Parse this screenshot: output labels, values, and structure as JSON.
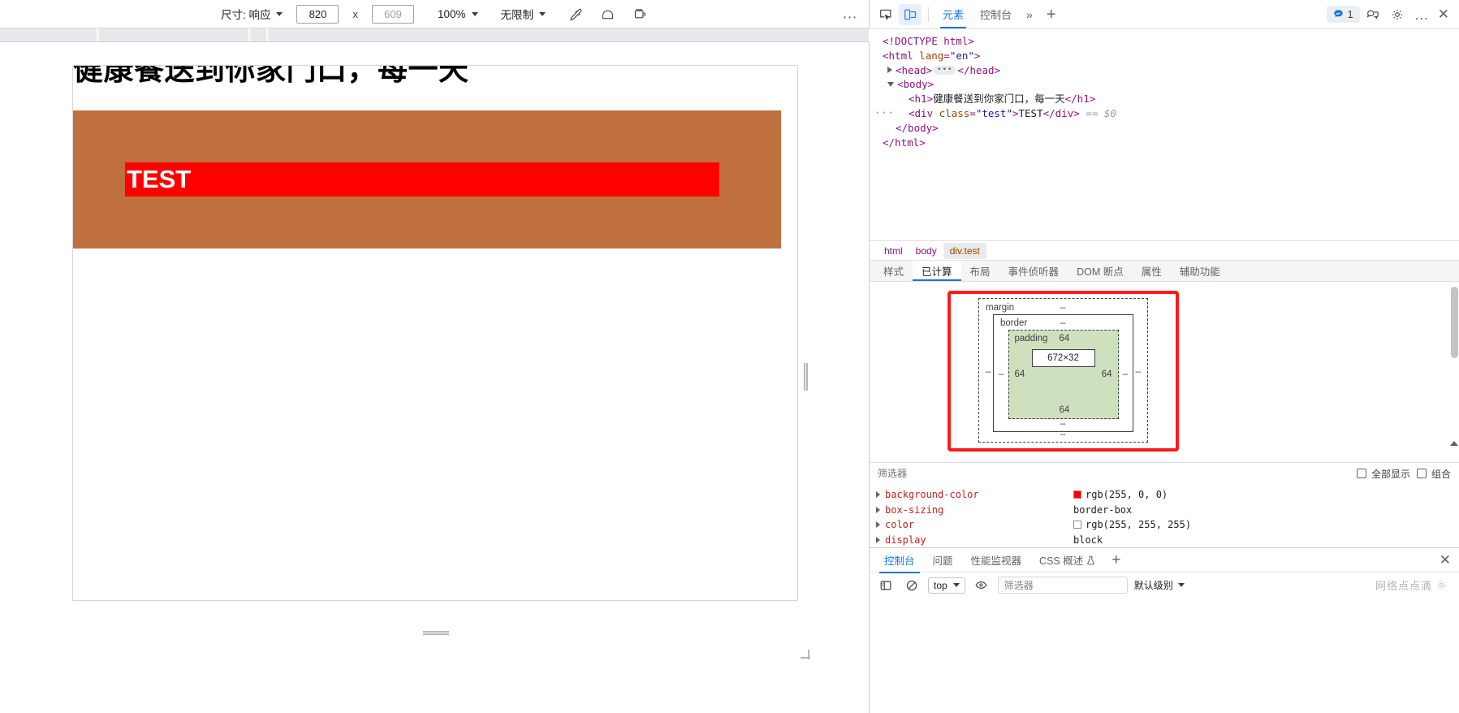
{
  "device_toolbar": {
    "size_label": "尺寸: 响应",
    "width_value": "820",
    "height_value": "609",
    "times": "x",
    "zoom_label": "100%",
    "throttle_label": "无限制",
    "icons": {
      "eyedropper": "eyedropper-icon",
      "rotate": "rotate-icon",
      "screenshot": "screenshot-icon",
      "more": "…"
    }
  },
  "page_preview": {
    "heading": "健康餐送到你家门口，每一天",
    "test_text": "TEST",
    "banner_color": "#c0703f",
    "test_bg_color": "#ff0000",
    "test_text_color": "#ffffff"
  },
  "devtools": {
    "header": {
      "inspect_icon": "inspect-element-icon",
      "device_icon": "device-toolbar-icon",
      "tabs": [
        {
          "label": "元素",
          "active": true
        },
        {
          "label": "控制台",
          "active": false
        }
      ],
      "overflow": "»",
      "add_tab": "+",
      "message_count": "1",
      "feedback_icon": "feedback-icon",
      "settings_icon": "gear-icon",
      "more_icon": "…",
      "close_icon": "✕"
    },
    "dom_tree": {
      "lines": [
        {
          "indent": 0,
          "content": "<!DOCTYPE html>"
        },
        {
          "indent": 0,
          "content": "<html lang=\"en\">"
        },
        {
          "indent": 1,
          "content": "<head> … </head>"
        },
        {
          "indent": 1,
          "content": "<body>"
        },
        {
          "indent": 2,
          "content": "<h1>健康餐送到你家门口，每一天</h1>"
        },
        {
          "indent": 2,
          "content": "<div class=\"test\">TEST</div> == $0"
        },
        {
          "indent": 1,
          "content": "</body>"
        },
        {
          "indent": 0,
          "content": "</html>"
        }
      ],
      "doctype_text": "<!DOCTYPE html>",
      "html_tag_open": "<html",
      "html_attr_name": "lang",
      "html_attr_value": "\"en\"",
      "head_open": "<head>",
      "head_close": "</head>",
      "body_open": "<body>",
      "h1_open": "<h1>",
      "h1_text": "健康餐送到你家门口，每一天",
      "h1_close": "</h1>",
      "div_open": "<div",
      "div_attr_name": "class",
      "div_attr_value": "\"test\"",
      "div_gt": ">",
      "div_text": "TEST",
      "div_close": "</div>",
      "selected_marker": "== $0",
      "body_close": "</body>",
      "html_close": "</html>",
      "gutter_dots": "···"
    },
    "breadcrumb": [
      {
        "label": "html",
        "active": false
      },
      {
        "label": "body",
        "active": false
      },
      {
        "label": "div.test",
        "active": true
      }
    ],
    "subtabs": [
      {
        "label": "样式",
        "active": false
      },
      {
        "label": "已计算",
        "active": true
      },
      {
        "label": "布局",
        "active": false
      },
      {
        "label": "事件侦听器",
        "active": false
      },
      {
        "label": "DOM 断点",
        "active": false
      },
      {
        "label": "属性",
        "active": false
      },
      {
        "label": "辅助功能",
        "active": false
      }
    ],
    "box_model": {
      "margin_label": "margin",
      "margin_top": "–",
      "margin_right": "–",
      "margin_bottom": "–",
      "margin_left": "–",
      "border_label": "border",
      "border_top": "–",
      "border_right": "–",
      "border_bottom": "–",
      "border_left": "–",
      "padding_label": "padding",
      "padding_top": "64",
      "padding_right": "64",
      "padding_bottom": "64",
      "padding_left": "64",
      "content_size": "672×32",
      "highlight_color": "#ff1a1a"
    },
    "filter_row": {
      "placeholder": "筛选器",
      "show_all_label": "全部显示",
      "group_label": "组合"
    },
    "computed_properties": [
      {
        "name": "background-color",
        "value": "rgb(255, 0, 0)",
        "swatch": "#ff0000"
      },
      {
        "name": "box-sizing",
        "value": "border-box",
        "swatch": null
      },
      {
        "name": "color",
        "value": "rgb(255, 255, 255)",
        "swatch": "#ffffff"
      },
      {
        "name": "display",
        "value": "block",
        "swatch": null
      }
    ],
    "drawer": {
      "tabs": [
        {
          "label": "控制台",
          "active": true
        },
        {
          "label": "问题",
          "active": false
        },
        {
          "label": "性能监视器",
          "active": false
        },
        {
          "label": "CSS 概述",
          "active": false
        }
      ],
      "css_overview_badge": "beaker-icon",
      "add_tab": "+",
      "close_icon": "✕",
      "console_bar": {
        "sidebar_icon": "console-sidebar-icon",
        "clear_icon": "clear-console-icon",
        "context_value": "top",
        "eye_icon": "live-expression-icon",
        "filter_placeholder": "筛选器",
        "level_label": "默认级别",
        "watermark": "网络点点滴"
      }
    }
  }
}
